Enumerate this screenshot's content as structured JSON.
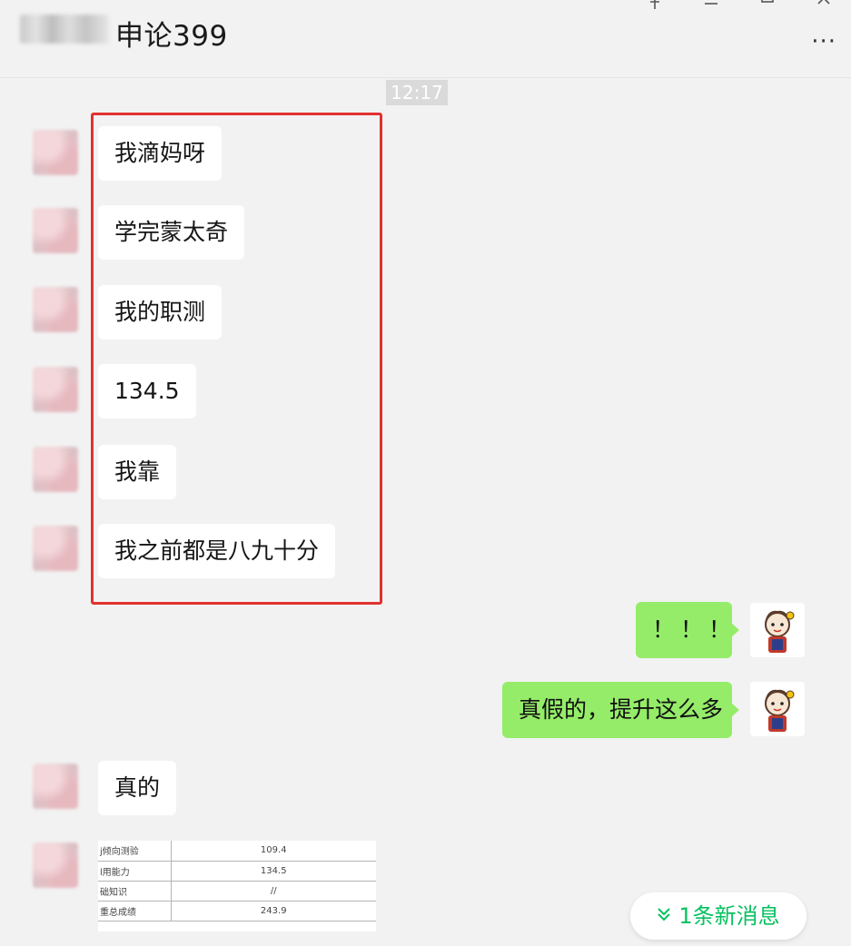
{
  "header": {
    "title": "申论399",
    "controls": [
      "pin-icon",
      "minimize-icon",
      "maximize-icon",
      "close-icon"
    ],
    "more": "···"
  },
  "timestamp": "12:17",
  "messages": {
    "received_highlighted": [
      "我滴妈呀",
      "学完蒙太奇",
      "我的职测",
      "134.5",
      "我靠",
      "我之前都是八九十分"
    ],
    "sent": [
      "！！！",
      "真假的，提升这么多"
    ],
    "received_after": [
      "真的"
    ]
  },
  "score_image": {
    "rows": [
      {
        "label": "j倾向测验",
        "value": "109.4"
      },
      {
        "label": "l用能力",
        "value": "134.5"
      },
      {
        "label": "础知识",
        "value": "//"
      },
      {
        "label": "重总成绩",
        "value": "243.9"
      }
    ]
  },
  "new_message_pill": {
    "label": "1条新消息",
    "icon": "double-chevron-down-icon"
  },
  "colors": {
    "background": "#f2f2f2",
    "sent_bubble": "#95ec69",
    "received_bubble": "#ffffff",
    "highlight_box": "#e0322f",
    "accent_green": "#07c160"
  }
}
